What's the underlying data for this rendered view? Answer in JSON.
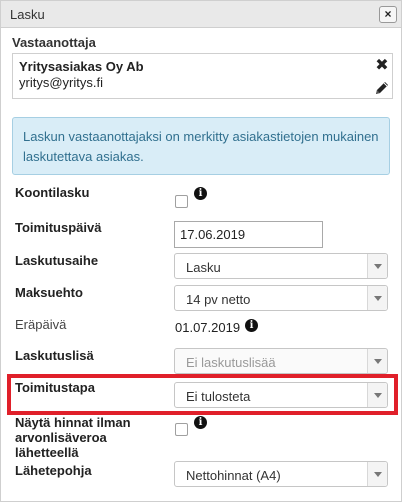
{
  "dialog": {
    "title": "Lasku",
    "close_label": "×"
  },
  "recipient": {
    "label": "Vastaanottaja",
    "name": "Yritysasiakas Oy Ab",
    "email": "yritys@yritys.fi",
    "remove_icon": "close-icon",
    "edit_icon": "pencil-icon"
  },
  "info": {
    "text": "Laskun vastaanottajaksi on merkitty asiakastietojen mukainen laskutettava asiakas."
  },
  "fields": {
    "koontilasku": {
      "label": "Koontilasku",
      "checked": false
    },
    "toimituspaiva": {
      "label": "Toimituspäivä",
      "value": "17.06.2019"
    },
    "laskutusaihe": {
      "label": "Laskutusaihe",
      "value": "Lasku"
    },
    "maksuehto": {
      "label": "Maksuehto",
      "value": "14 pv netto"
    },
    "erapaiva": {
      "label": "Eräpäivä",
      "value": "01.07.2019"
    },
    "laskutuslisa": {
      "label": "Laskutuslisä",
      "placeholder": "Ei laskutuslisää"
    },
    "toimitustapa": {
      "label": "Toimitustapa",
      "value": "Ei tulosteta"
    },
    "nayta_hinnat": {
      "label_line1": "Näytä hinnat ilman",
      "label_line2": "arvonlisäveroa",
      "label_line3": "lähetteellä",
      "checked": false
    },
    "lahetepohja": {
      "label": "Lähetepohja",
      "value": "Nettohinnat (A4)"
    }
  },
  "colors": {
    "highlight": "#e0202a",
    "info_bg": "#d9edf7",
    "info_text": "#31708f"
  }
}
